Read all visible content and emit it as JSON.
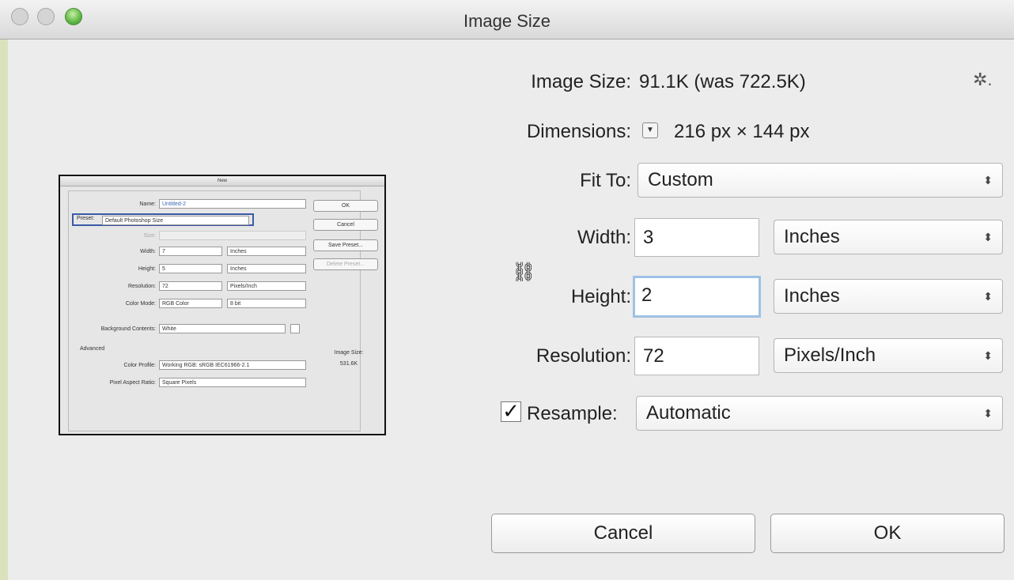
{
  "window": {
    "title": "Image Size"
  },
  "preview": {
    "title": "New",
    "name_label": "Name:",
    "name_value": "Untitled-2",
    "preset_label": "Preset:",
    "preset_value": "Default Photoshop Size",
    "size_label": "Size:",
    "width_label": "Width:",
    "width_value": "7",
    "width_unit": "Inches",
    "height_label": "Height:",
    "height_value": "5",
    "height_unit": "Inches",
    "resolution_label": "Resolution:",
    "resolution_value": "72",
    "resolution_unit": "Pixels/Inch",
    "color_mode_label": "Color Mode:",
    "color_mode_value": "RGB Color",
    "bit_depth": "8 bit",
    "background_label": "Background Contents:",
    "background_value": "White",
    "advanced_label": "Advanced",
    "color_profile_label": "Color Profile:",
    "color_profile_value": "Working RGB: sRGB IEC61966-2.1",
    "pixel_aspect_label": "Pixel Aspect Ratio:",
    "pixel_aspect_value": "Square Pixels",
    "image_size_label": "Image Size:",
    "image_size_value": "531.6K",
    "ok_label": "OK",
    "cancel_label": "Cancel",
    "save_preset_label": "Save Preset...",
    "delete_preset_label": "Delete Preset..."
  },
  "form": {
    "image_size_label": "Image Size:",
    "image_size_value": "91.1K (was 722.5K)",
    "gear_icon_glyph": "✲.",
    "dimensions_label": "Dimensions:",
    "dimensions_value": "216 px  ×  144 px",
    "fit_to_label": "Fit To:",
    "fit_to_value": "Custom",
    "width_label": "Width:",
    "width_value": "3",
    "width_unit": "Inches",
    "height_label": "Height:",
    "height_value": "2",
    "height_unit": "Inches",
    "resolution_label": "Resolution:",
    "resolution_value": "72",
    "resolution_unit": "Pixels/Inch",
    "resample_label": "Resample:",
    "resample_checked": true,
    "resample_value": "Automatic"
  },
  "buttons": {
    "cancel_label": "Cancel",
    "ok_label": "OK"
  }
}
